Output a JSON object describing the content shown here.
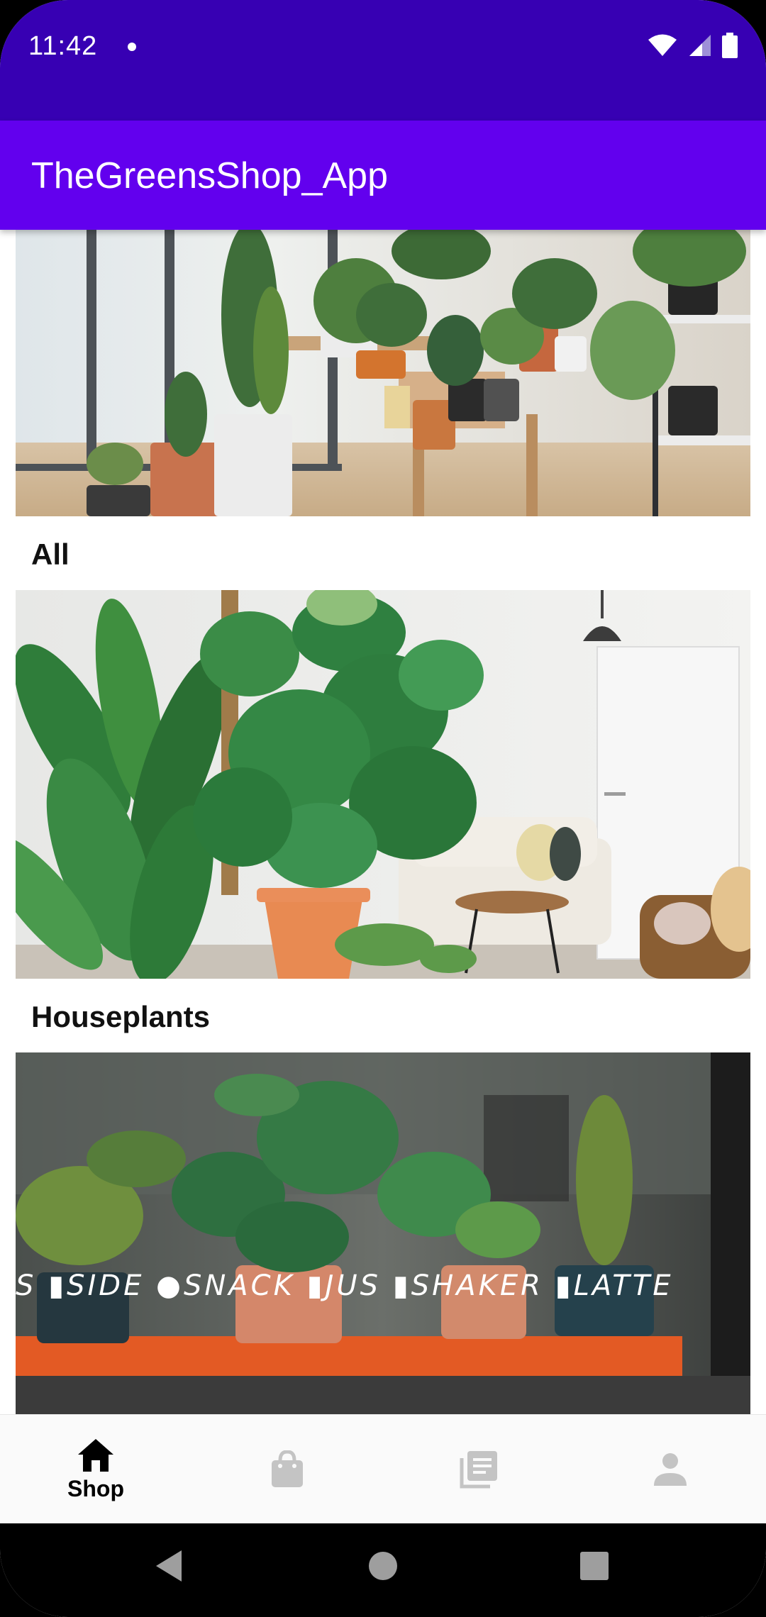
{
  "status_bar": {
    "time": "11:42",
    "background": "#3700B3",
    "icons": [
      "wifi-icon",
      "cellular-icon",
      "battery-icon"
    ]
  },
  "app_bar": {
    "title": "TheGreensShop_App",
    "background": "#6200EE"
  },
  "categories": [
    {
      "label": "All"
    },
    {
      "label": "Houseplants"
    }
  ],
  "bottom_nav": {
    "items": [
      {
        "label": "Shop",
        "icon": "home-icon",
        "selected": true
      },
      {
        "label": "",
        "icon": "shopping-bag-icon",
        "selected": false
      },
      {
        "label": "",
        "icon": "library-icon",
        "selected": false
      },
      {
        "label": "",
        "icon": "person-icon",
        "selected": false
      }
    ]
  },
  "system_nav": {
    "icons": [
      "back-icon",
      "home-circle-icon",
      "recents-icon"
    ]
  },
  "colors": {
    "accent": "#6200EE",
    "status": "#3700B3",
    "nav_inactive": "#c4c4c4"
  }
}
